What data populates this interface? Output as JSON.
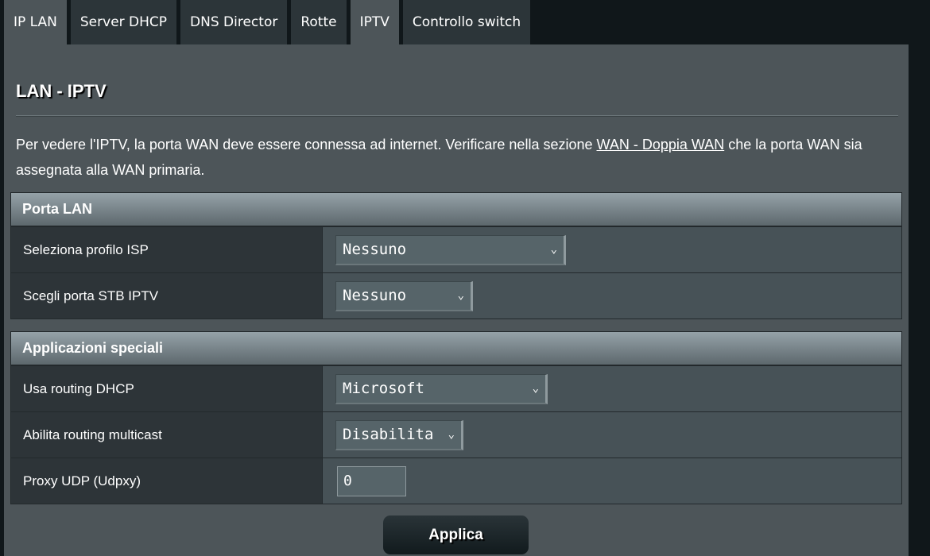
{
  "tabs": [
    "IP LAN",
    "Server DHCP",
    "DNS Director",
    "Rotte",
    "IPTV",
    "Controllo switch"
  ],
  "title": "LAN - IPTV",
  "description": {
    "before": "Per vedere l'IPTV, la porta WAN deve essere connessa ad internet. Verificare nella sezione ",
    "link": "WAN - Doppia WAN",
    "after": " che la porta WAN sia assegnata alla WAN primaria."
  },
  "porta_lan": {
    "header": "Porta LAN",
    "isp_label": "Seleziona profilo ISP",
    "isp_value": "Nessuno",
    "stb_label": "Scegli porta STB IPTV",
    "stb_value": "Nessuno"
  },
  "app_speciali": {
    "header": "Applicazioni speciali",
    "dhcp_label": "Usa routing DHCP",
    "dhcp_value": "Microsoft",
    "multicast_label": "Abilita routing multicast",
    "multicast_value": "Disabilita",
    "udpxy_label": "Proxy UDP (Udpxy)",
    "udpxy_value": "0"
  },
  "apply_label": "Applica",
  "chevron": "⌄"
}
